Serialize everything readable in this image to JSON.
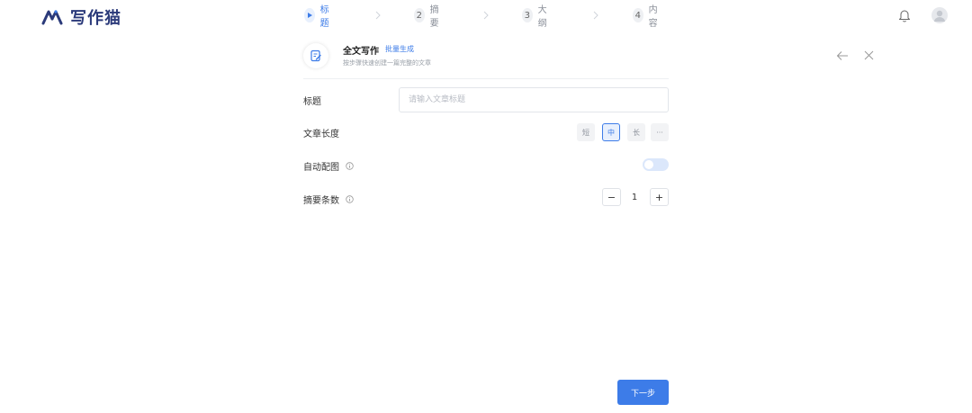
{
  "app": {
    "logo_text": "写作猫"
  },
  "steps": [
    {
      "label": "标题",
      "active": true
    },
    {
      "number": "2",
      "label": "摘要"
    },
    {
      "number": "3",
      "label": "大纲"
    },
    {
      "number": "4",
      "label": "内容"
    }
  ],
  "icons": {
    "step_active": "play-icon",
    "step_separator": "chevron-right-icon",
    "notification": "bell-icon",
    "user": "avatar-icon",
    "header": "edit-document-icon",
    "back": "arrow-left-icon",
    "close": "close-icon",
    "info": "info-icon"
  },
  "header": {
    "title": "全文写作",
    "badge": "批量生成",
    "subtitle": "按步骤快速创建一篇完整的文章"
  },
  "form": {
    "title": {
      "label": "标题",
      "placeholder": "请输入文章标题",
      "value": ""
    },
    "length": {
      "label": "文章长度",
      "options": [
        "短",
        "中",
        "长",
        "···"
      ],
      "selected": "中"
    },
    "auto_image": {
      "label": "自动配图",
      "enabled": false
    },
    "summary_count": {
      "label": "摘要条数",
      "minus": "−",
      "value": "1",
      "plus": "+"
    }
  },
  "footer": {
    "next_label": "下一步"
  },
  "colors": {
    "accent": "#3d7ce8",
    "logo": "#2b3a7a",
    "toggle_off": "#dbe7fb"
  }
}
